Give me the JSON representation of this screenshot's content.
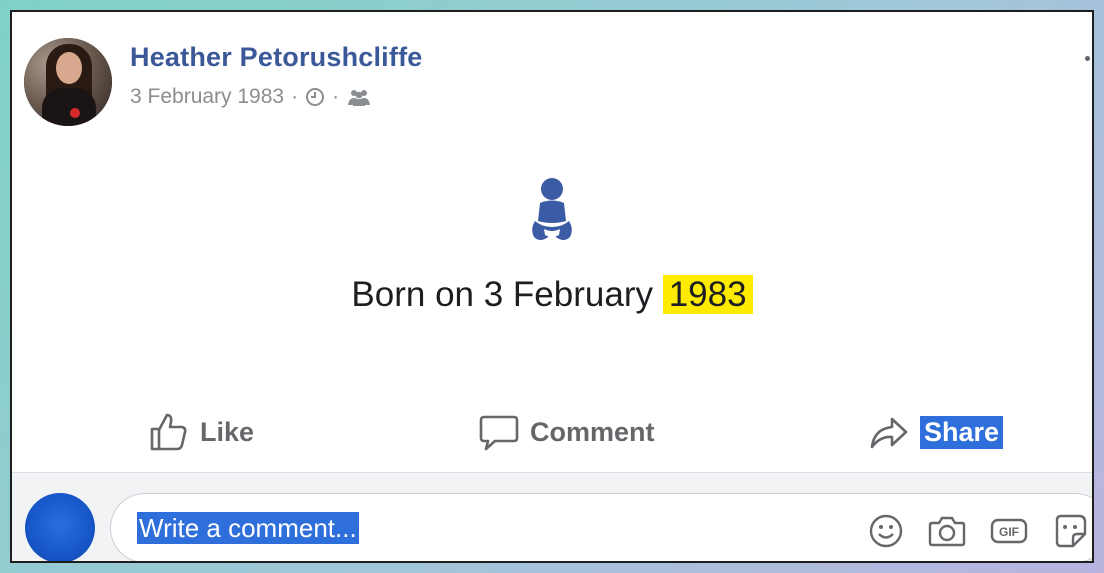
{
  "post": {
    "author_name": "Heather Petorushcliffe",
    "date": "3 February 1983",
    "separator": "·"
  },
  "life_event": {
    "icon": "baby-icon",
    "text_prefix": "Born on 3 February ",
    "text_highlight": "1983"
  },
  "actions": {
    "like_label": "Like",
    "comment_label": "Comment",
    "share_label": "Share"
  },
  "comment_composer": {
    "placeholder": "Write a comment...",
    "tools": [
      "emoji-icon",
      "camera-icon",
      "gif-icon",
      "sticker-icon"
    ]
  },
  "colors": {
    "name_link": "#3b5998",
    "highlight": "#ffeb00",
    "selection": "#2f6fdc",
    "muted_text": "#8a8d91"
  }
}
